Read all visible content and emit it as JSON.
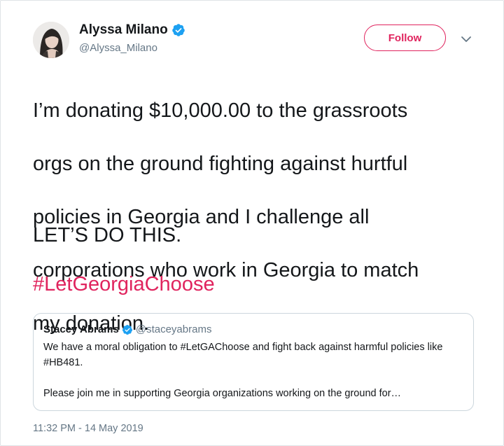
{
  "author": {
    "display_name": "Alyssa Milano",
    "handle": "@Alyssa_Milano",
    "verified": true
  },
  "follow_button": {
    "label": "Follow"
  },
  "tweet": {
    "lines": [
      "I’m donating $10,000.00 to the grassroots",
      "orgs on the ground fighting against hurtful",
      "policies in Georgia and I challenge all",
      "corporations who work in Georgia to match",
      "my donation."
    ],
    "shout": "LET’S DO THIS.",
    "hashtag": "#LetGeorgiaChoose"
  },
  "quoted_tweet": {
    "display_name": "Stacey Abrams",
    "handle": "@staceyabrams",
    "verified": true,
    "paragraph_1": "We have a moral obligation to #LetGAChoose and fight back against harmful policies like #HB481.",
    "paragraph_2": "Please join me in supporting Georgia organizations working on the ground for…"
  },
  "timestamp": "11:32 PM - 14 May 2019",
  "colors": {
    "accent": "#e0245e",
    "verified": "#1da1f2",
    "secondary_text": "#657786",
    "border": "#ccd6dd"
  },
  "icons": {
    "verified": "verified-badge-icon",
    "caret": "chevron-down-icon"
  }
}
